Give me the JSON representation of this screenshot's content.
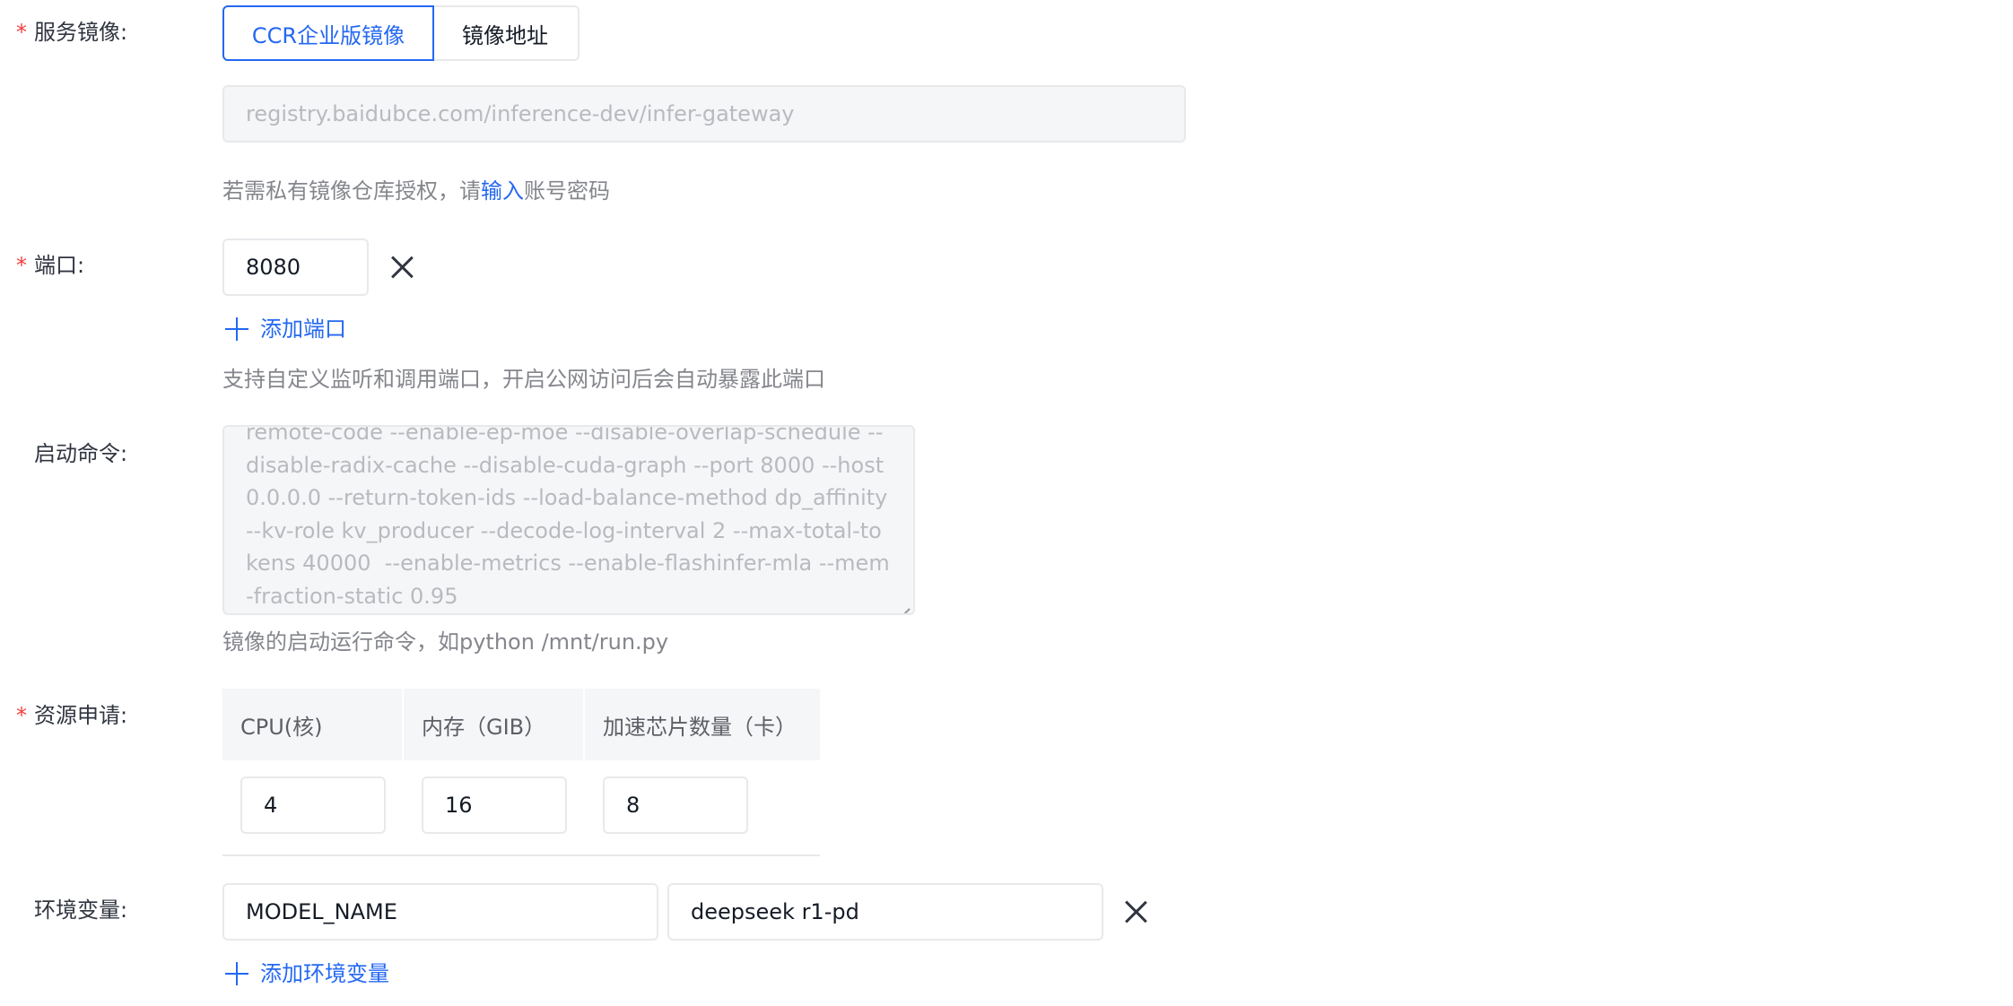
{
  "image": {
    "label": "服务镜像:",
    "tabs": [
      "CCR企业版镜像",
      "镜像地址"
    ],
    "active_tab": "CCR企业版镜像",
    "address_value": "registry.baidubce.com/inference-dev/infer-gateway",
    "help_prefix": "若需私有镜像仓库授权，请",
    "help_link": "输入",
    "help_suffix": "账号密码"
  },
  "port": {
    "label": "端口:",
    "value": "8080",
    "add_label": "添加端口",
    "help": "支持自定义监听和调用端口，开启公网访问后会自动暴露此端口"
  },
  "command": {
    "label": "启动命令:",
    "value": "remote-code --enable-ep-moe --disable-overlap-schedule --disable-radix-cache --disable-cuda-graph --port 8000 --host 0.0.0.0 --return-token-ids --load-balance-method dp_affinity --kv-role kv_producer --decode-log-interval 2 --max-total-tokens 40000  --enable-metrics --enable-flashinfer-mla --mem-fraction-static 0.95",
    "help": "镜像的启动运行命令，如python /mnt/run.py"
  },
  "resources": {
    "label": "资源申请:",
    "headers": [
      "CPU(核)",
      "内存（GIB）",
      "加速芯片数量（卡）"
    ],
    "values": [
      "4",
      "16",
      "8"
    ]
  },
  "env": {
    "label": "环境变量:",
    "key": "MODEL_NAME",
    "value": "deepseek r1-pd",
    "add_label": "添加环境变量"
  },
  "colors": {
    "primary": "#2468f2",
    "required": "#f33e3e",
    "border": "#e8e9eb",
    "disabled_bg": "#f5f6f7"
  }
}
